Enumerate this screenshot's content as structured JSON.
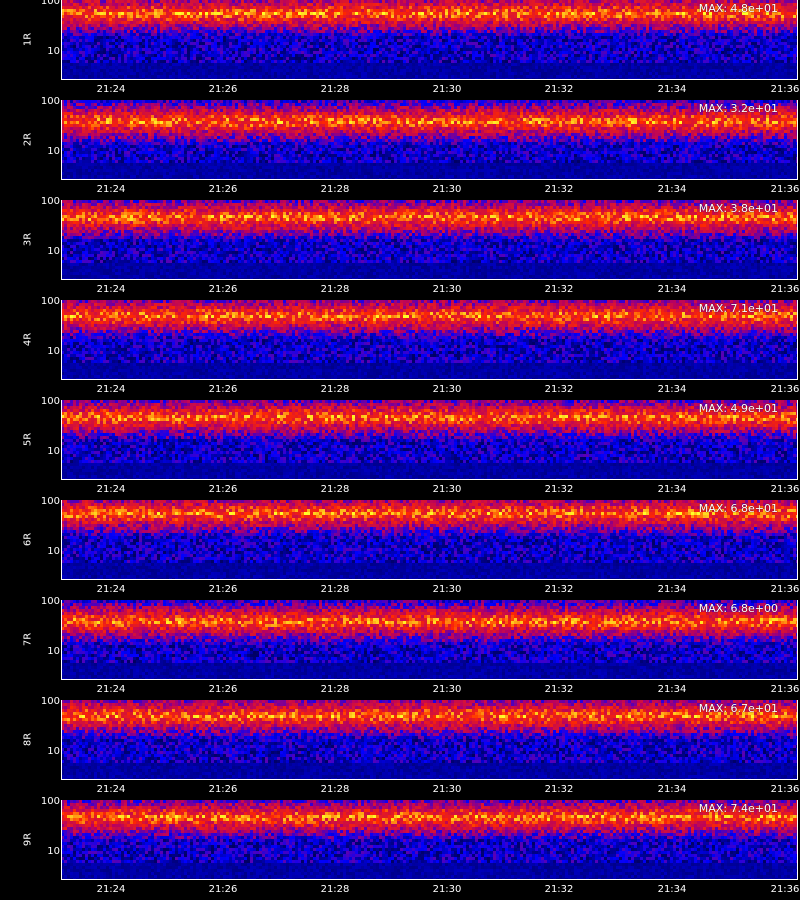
{
  "chart_data": {
    "type": "heatmap",
    "x_tick_labels": [
      "21:24",
      "21:26",
      "21:28",
      "21:30",
      "21:32",
      "21:34",
      "21:36"
    ],
    "y_tick_labels": [
      "100",
      "10"
    ],
    "y_scale": "log",
    "colormap": [
      "#000000",
      "#0000ff",
      "#ff0000",
      "#ffff00"
    ],
    "panels": [
      {
        "label": "1R",
        "max_label": "MAX: 4.8e+01",
        "peak_band": 0.15
      },
      {
        "label": "2R",
        "max_label": "MAX: 3.2e+01",
        "peak_band": 0.25
      },
      {
        "label": "3R",
        "max_label": "MAX: 3.8e+01",
        "peak_band": 0.2
      },
      {
        "label": "4R",
        "max_label": "MAX: 7.1e+01",
        "peak_band": 0.18
      },
      {
        "label": "5R",
        "max_label": "MAX: 4.9e+01",
        "peak_band": 0.2
      },
      {
        "label": "6R",
        "max_label": "MAX: 6.8e+01",
        "peak_band": 0.15
      },
      {
        "label": "7R",
        "max_label": "MAX: 6.8e+00",
        "peak_band": 0.25
      },
      {
        "label": "8R",
        "max_label": "MAX: 6.7e+01",
        "peak_band": 0.18
      },
      {
        "label": "9R",
        "max_label": "MAX: 7.4e+01",
        "peak_band": 0.2
      }
    ]
  }
}
